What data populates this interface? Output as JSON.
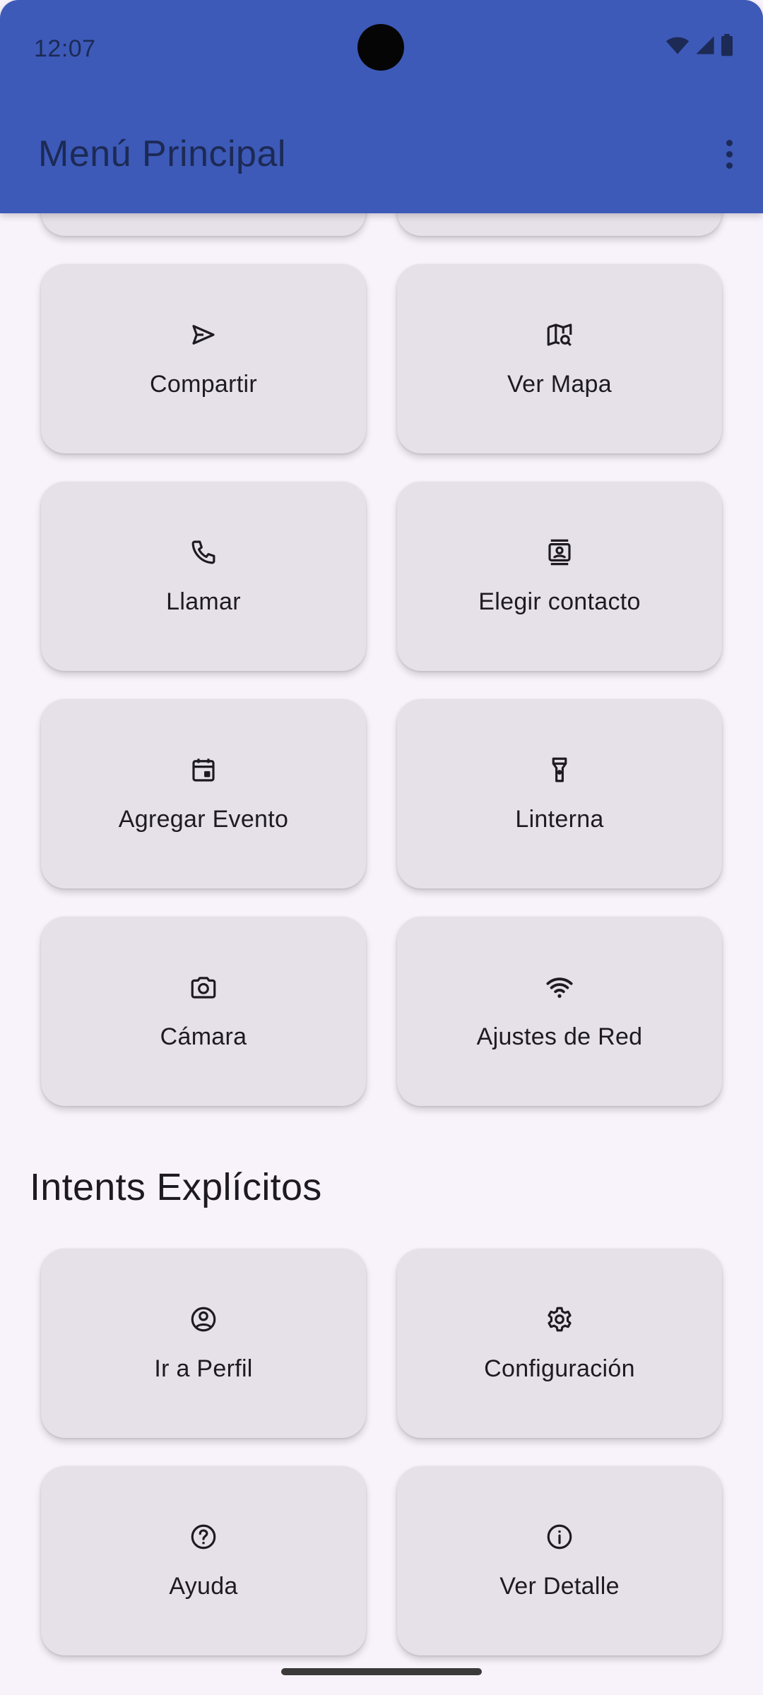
{
  "status_bar": {
    "time": "12:07"
  },
  "app_bar": {
    "title": "Menú Principal"
  },
  "implicit_items": [
    {
      "label": "Compartir",
      "icon": "send-icon"
    },
    {
      "label": "Ver Mapa",
      "icon": "map-search-icon"
    },
    {
      "label": "Llamar",
      "icon": "phone-icon"
    },
    {
      "label": "Elegir contacto",
      "icon": "contact-card-icon"
    },
    {
      "label": "Agregar Evento",
      "icon": "calendar-event-icon"
    },
    {
      "label": "Linterna",
      "icon": "flashlight-icon"
    },
    {
      "label": "Cámara",
      "icon": "camera-icon"
    },
    {
      "label": "Ajustes de Red",
      "icon": "wifi-icon"
    }
  ],
  "explicit_section": {
    "title": "Intents Explícitos",
    "items": [
      {
        "label": "Ir a Perfil",
        "icon": "account-circle-icon"
      },
      {
        "label": "Configuración",
        "icon": "settings-icon"
      },
      {
        "label": "Ayuda",
        "icon": "help-icon"
      },
      {
        "label": "Ver Detalle",
        "icon": "info-icon"
      }
    ]
  },
  "colors": {
    "app_bar": "#3d5ab8",
    "card": "#e6e0e9",
    "background": "#f8f2fb"
  }
}
